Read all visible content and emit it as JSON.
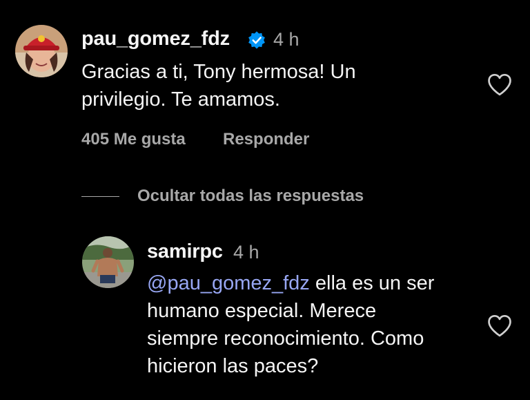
{
  "comments": [
    {
      "username": "pau_gomez_fdz",
      "verified": true,
      "time": "4 h",
      "text_lines": [
        "Gracias a ti, Tony hermosa! Un",
        "privilegio. Te amamos."
      ],
      "likes_label": "405 Me gusta",
      "reply_label": "Responder",
      "avatar_icon": "avatar-woman-red-cap",
      "like_icon": "heart-outline-icon"
    }
  ],
  "hide_replies_label": "Ocultar todas las respuestas",
  "replies": [
    {
      "username": "samirpc",
      "time": "4 h",
      "mention": "@pau_gomez_fdz",
      "text_first_line_rest": " ella es un ser",
      "text_lines": [
        "humano especial. Merece",
        "siempre reconocimiento. Como",
        "hicieron las paces?"
      ],
      "avatar_icon": "avatar-man-outdoors",
      "like_icon": "heart-outline-icon"
    }
  ],
  "colors": {
    "background": "#000000",
    "primary_text": "#f5f5f5",
    "secondary_text": "#a8a8a8",
    "mention": "#98a7f4",
    "verified_badge": "#0095f6"
  }
}
